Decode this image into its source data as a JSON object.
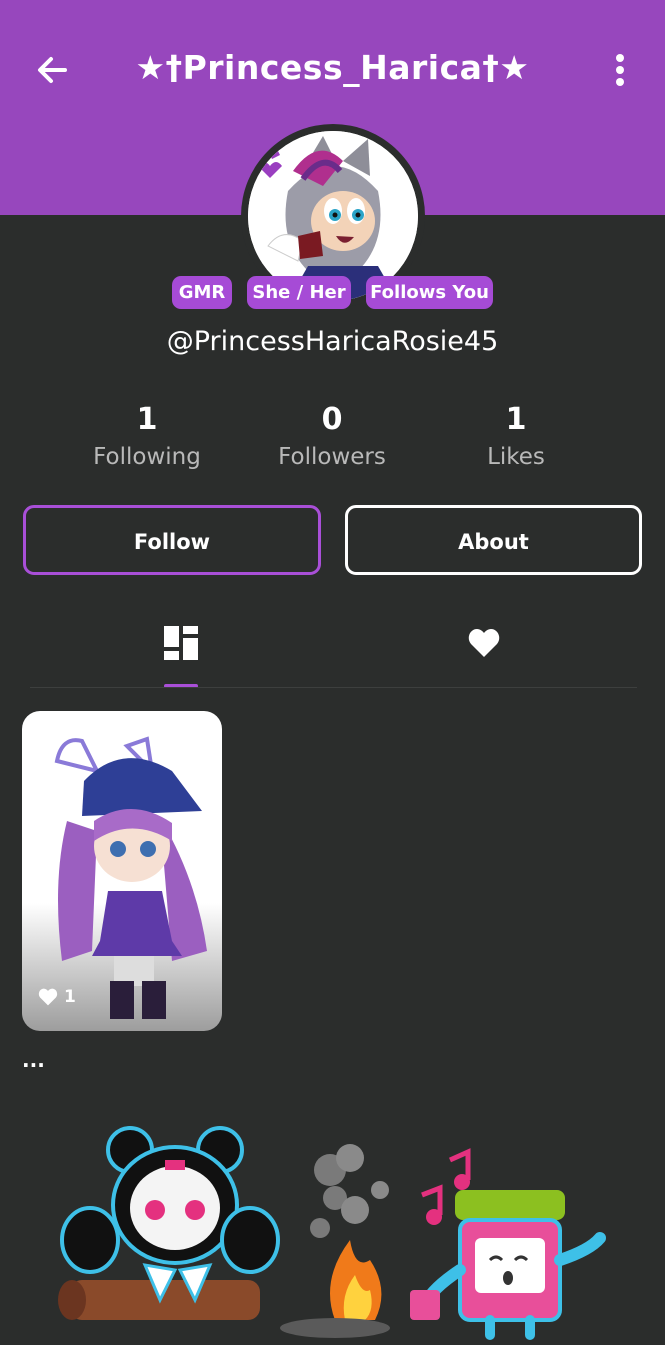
{
  "header": {
    "title": "★†Princess_Harica†★",
    "background_color": "#9747bd",
    "back_icon": "arrow-left-icon",
    "menu_icon": "more-vertical-icon"
  },
  "profile": {
    "avatar_description_icon": "avatar-image",
    "badges": [
      "GMR",
      "She / Her",
      "Follows You"
    ],
    "handle": "@PrincessHaricaRosie45"
  },
  "stats": [
    {
      "value": "1",
      "label": "Following"
    },
    {
      "value": "0",
      "label": "Followers"
    },
    {
      "value": "1",
      "label": "Likes"
    }
  ],
  "actions": {
    "follow_label": "Follow",
    "about_label": "About",
    "accent_color": "#a94fd8"
  },
  "tabs": [
    {
      "icon": "grid-icon",
      "selected": true
    },
    {
      "icon": "heart-icon",
      "selected": false
    }
  ],
  "posts": [
    {
      "likes": "1"
    }
  ],
  "more_text": "..."
}
